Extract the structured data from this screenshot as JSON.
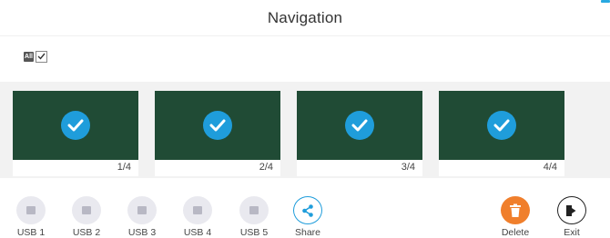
{
  "header": {
    "title": "Navigation"
  },
  "select_all": {
    "tag": "All",
    "checked": true
  },
  "thumbnails": [
    {
      "page_label": "1/4",
      "selected": true
    },
    {
      "page_label": "2/4",
      "selected": true
    },
    {
      "page_label": "3/4",
      "selected": true
    },
    {
      "page_label": "4/4",
      "selected": true
    }
  ],
  "toolbar": {
    "usb1_label": "USB 1",
    "usb2_label": "USB 2",
    "usb3_label": "USB 3",
    "usb4_label": "USB 4",
    "usb5_label": "USB 5",
    "share_label": "Share",
    "delete_label": "Delete",
    "exit_label": "Exit"
  },
  "colors": {
    "accent": "#1f9ddb",
    "thumbnail_bg": "#204b35",
    "delete": "#f07f2c"
  },
  "icons": {
    "usb": "usb-drive-icon",
    "share": "share-icon",
    "delete": "trash-icon",
    "exit": "exit-door-icon",
    "check": "check-icon"
  }
}
